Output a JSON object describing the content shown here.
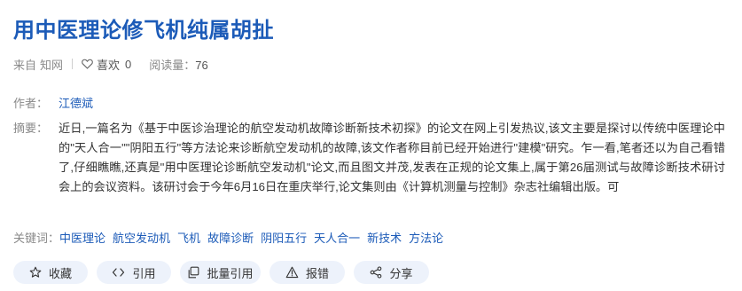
{
  "article": {
    "title": "用中医理论修飞机纯属胡扯"
  },
  "meta": {
    "source_label": "来自",
    "source_name": "知网",
    "like_label": "喜欢",
    "like_count": "0",
    "reads_label": "阅读量：",
    "reads_count": "76"
  },
  "author": {
    "label": "作者：",
    "name": "江德斌"
  },
  "abstract": {
    "label": "摘要：",
    "text": "近日,一篇名为《基于中医诊治理论的航空发动机故障诊断新技术初探》的论文在网上引发热议,该文主要是探讨以传统中医理论中的\"天人合一\"\"阴阳五行\"等方法论来诊断航空发动机的故障,该文作者称目前已经开始进行\"建模\"研究。乍一看,笔者还以为自己看错了,仔细瞧瞧,还真是\"用中医理论诊断航空发动机\"论文,而且图文并茂,发表在正规的论文集上,属于第26届测试与故障诊断技术研讨会上的会议资料。该研讨会于今年6月16日在重庆举行,论文集则由《计算机测量与控制》杂志社编辑出版。可"
  },
  "keywords": {
    "label": "关键词：",
    "items": [
      "中医理论",
      "航空发动机",
      "飞机",
      "故障诊断",
      "阴阳五行",
      "天人合一",
      "新技术",
      "方法论"
    ]
  },
  "actions": {
    "favorite": "收藏",
    "cite": "引用",
    "batch_cite": "批量引用",
    "report": "报错",
    "share": "分享"
  },
  "colors": {
    "accent": "#1c5bb8",
    "button_bg": "#edf2fb",
    "muted": "#8a8a8a"
  }
}
